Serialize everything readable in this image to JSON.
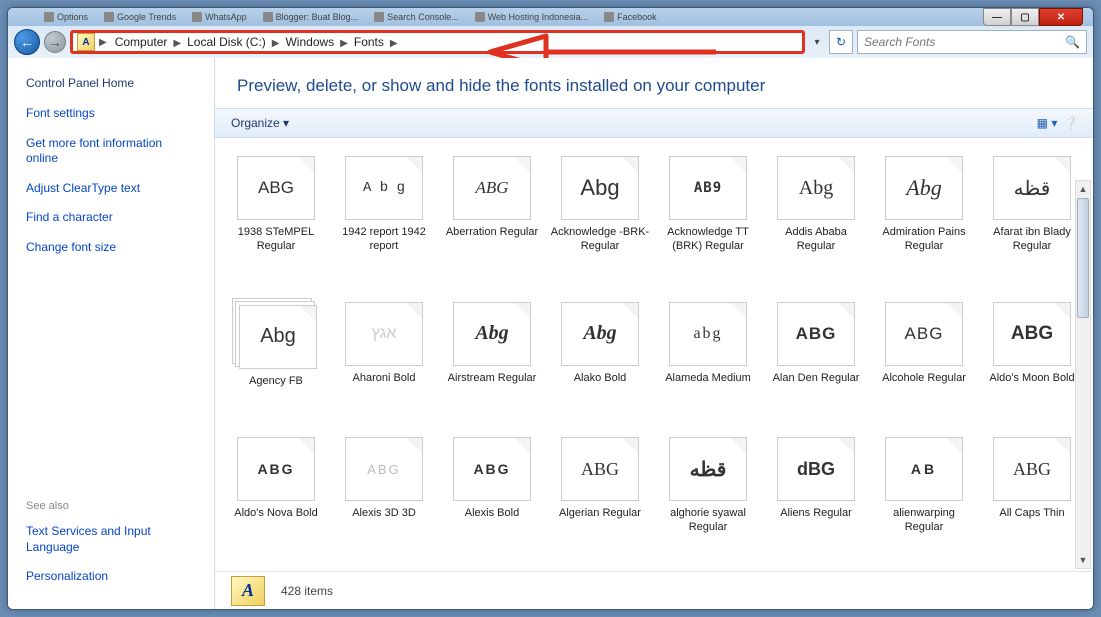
{
  "browser_tabs": [
    "Options",
    "Google Trends",
    "WhatsApp",
    "Blogger: Buat Blog...",
    "Search Console...",
    "Web Hosting Indonesia...",
    "Facebook"
  ],
  "window_controls": {
    "min": "—",
    "max": "▢",
    "close": "✕"
  },
  "nav": {
    "back": "←",
    "forward": "→",
    "refresh": "↻",
    "dropdown": "▾"
  },
  "breadcrumbs": [
    "Computer",
    "Local Disk (C:)",
    "Windows",
    "Fonts"
  ],
  "search": {
    "placeholder": "Search Fonts"
  },
  "sidebar": {
    "home": "Control Panel Home",
    "links": [
      "Font settings",
      "Get more font information online",
      "Adjust ClearType text",
      "Find a character",
      "Change font size"
    ],
    "see_also_label": "See also",
    "see_also": [
      "Text Services and Input Language",
      "Personalization"
    ]
  },
  "main_heading": "Preview, delete, or show and hide the fonts installed on your computer",
  "toolbar": {
    "organize": "Organize ▾"
  },
  "fonts": [
    {
      "sample": "ABG",
      "label": "1938 STeMPEL Regular",
      "stack": false,
      "style": ""
    },
    {
      "sample": "A b g",
      "label": "1942 report 1942 report",
      "stack": false,
      "style": "font-family: 'Courier New', monospace; font-size:14px;"
    },
    {
      "sample": "ABG",
      "label": "Aberration Regular",
      "stack": false,
      "style": "font-style:italic; font-family:cursive;"
    },
    {
      "sample": "Abg",
      "label": "Acknowledge -BRK- Regular",
      "stack": false,
      "style": "font-size:22px;"
    },
    {
      "sample": "AB9",
      "label": "Acknowledge TT (BRK) Regular",
      "stack": false,
      "style": "font-family:monospace; font-weight:bold; letter-spacing:1px; font-size:14px;"
    },
    {
      "sample": "Abg",
      "label": "Addis Ababa Regular",
      "stack": false,
      "style": "font-family:cursive; font-size:20px;"
    },
    {
      "sample": "Abg",
      "label": "Admiration Pains Regular",
      "stack": false,
      "style": "font-family:'Brush Script MT',cursive; font-size:22px; font-style:italic;"
    },
    {
      "sample": "قظه",
      "label": "Afarat ibn Blady Regular",
      "stack": false,
      "style": "font-size:20px;"
    },
    {
      "sample": "Abg",
      "label": "Agency FB",
      "stack": true,
      "style": "font-size:20px;"
    },
    {
      "sample": "אגץ",
      "label": "Aharoni Bold",
      "stack": false,
      "style": "color:#ccc; font-size:16px;"
    },
    {
      "sample": "Abg",
      "label": "Airstream Regular",
      "stack": false,
      "style": "font-family:cursive; font-weight:bold; font-style:italic; font-size:20px;"
    },
    {
      "sample": "Abg",
      "label": "Alako Bold",
      "stack": false,
      "style": "font-family:cursive; font-weight:bold; font-style:italic; font-size:20px;"
    },
    {
      "sample": "abg",
      "label": "Alameda Medium",
      "stack": false,
      "style": "font-family:cursive; font-size:16px; letter-spacing:2px;"
    },
    {
      "sample": "ABG",
      "label": "Alan Den Regular",
      "stack": false,
      "style": "font-weight:bold; letter-spacing:1px;"
    },
    {
      "sample": "ABG",
      "label": "Alcohole Regular",
      "stack": false,
      "style": "font-weight:300; letter-spacing:1px;"
    },
    {
      "sample": "ABG",
      "label": "Aldo's Moon Bold",
      "stack": false,
      "style": "font-weight:900; letter-spacing:0px; font-size:19px; font-family:Impact,sans-serif;"
    },
    {
      "sample": "ABG",
      "label": "Aldo's Nova Bold",
      "stack": false,
      "style": "font-weight:900; letter-spacing:2px; font-size:14px;"
    },
    {
      "sample": "ABG",
      "label": "Alexis 3D 3D",
      "stack": false,
      "style": "color:#bbb; letter-spacing:2px; font-size:13px;"
    },
    {
      "sample": "ABG",
      "label": "Alexis Bold",
      "stack": false,
      "style": "font-weight:900; letter-spacing:2px; font-size:14px; font-family:Impact,sans-serif;"
    },
    {
      "sample": "ABG",
      "label": "Algerian Regular",
      "stack": false,
      "style": "font-family:'Algerian',serif; font-size:18px;"
    },
    {
      "sample": "قظه",
      "label": "alghorie syawal Regular",
      "stack": false,
      "style": "font-weight:bold; font-size:20px;"
    },
    {
      "sample": "dBG",
      "label": "Aliens Regular",
      "stack": false,
      "style": "font-weight:bold; font-size:18px;"
    },
    {
      "sample": "AB",
      "label": "alienwarping Regular",
      "stack": false,
      "style": "font-weight:900; letter-spacing:3px; font-size:14px;"
    },
    {
      "sample": "ABG",
      "label": "All Caps Thin",
      "stack": false,
      "style": "font-family:'Comic Sans MS',cursive; font-size:18px;"
    }
  ],
  "status": {
    "items_count": "428 items",
    "icon_letter": "A"
  }
}
